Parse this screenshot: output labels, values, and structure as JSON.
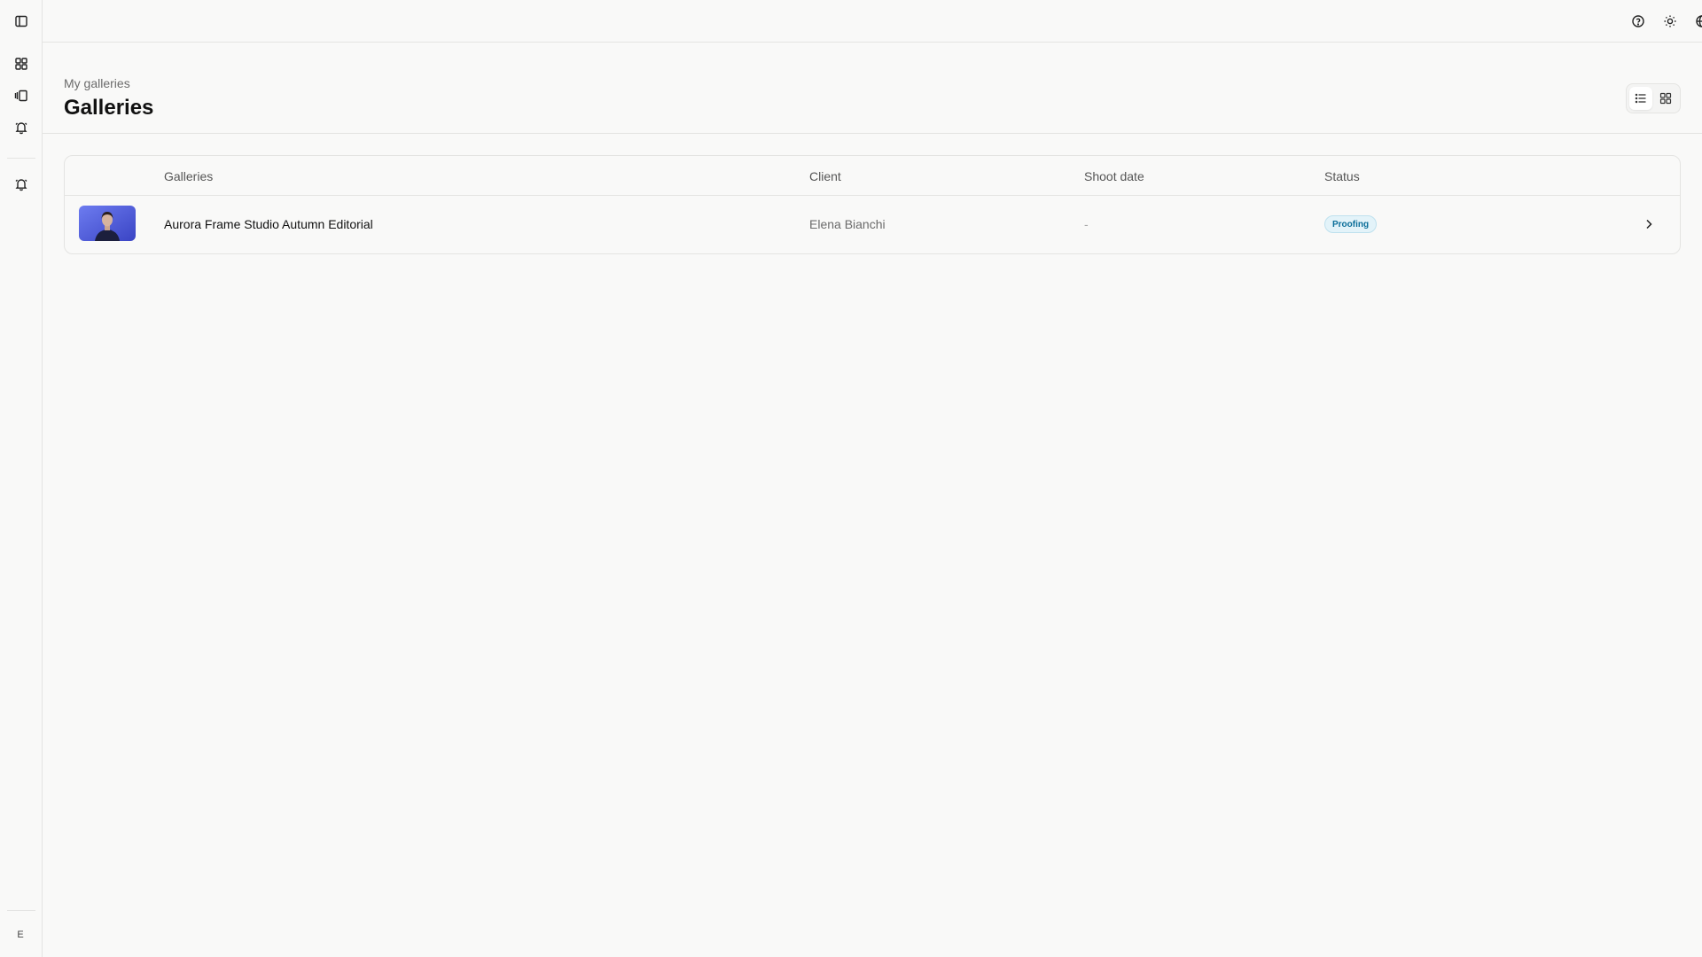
{
  "sidebar": {
    "toggle_icon": "sidebar-toggle-icon",
    "items": [
      {
        "icon": "dashboard-icon"
      },
      {
        "icon": "galleries-icon"
      },
      {
        "icon": "notifications-icon"
      },
      {
        "icon": "alerts-icon"
      }
    ],
    "avatar_initial": "E"
  },
  "topbar": {
    "icons": [
      "help-icon",
      "theme-icon",
      "language-icon"
    ]
  },
  "header": {
    "breadcrumb": "My galleries",
    "title": "Galleries",
    "view_modes": [
      "list-view-icon",
      "grid-view-icon"
    ],
    "active_view": "list"
  },
  "table": {
    "columns": {
      "galleries": "Galleries",
      "client": "Client",
      "shoot_date": "Shoot date",
      "status": "Status"
    },
    "rows": [
      {
        "name": "Aurora Frame Studio Autumn Editorial",
        "client": "Elena Bianchi",
        "shoot_date": "-",
        "status": "Proofing",
        "status_color": "#0b6e99",
        "status_bg": "#e3f3f9"
      }
    ]
  },
  "colors": {
    "background": "#f9f9f8",
    "border": "#e4e4e2",
    "thumb_bg": "#4a57d8"
  }
}
